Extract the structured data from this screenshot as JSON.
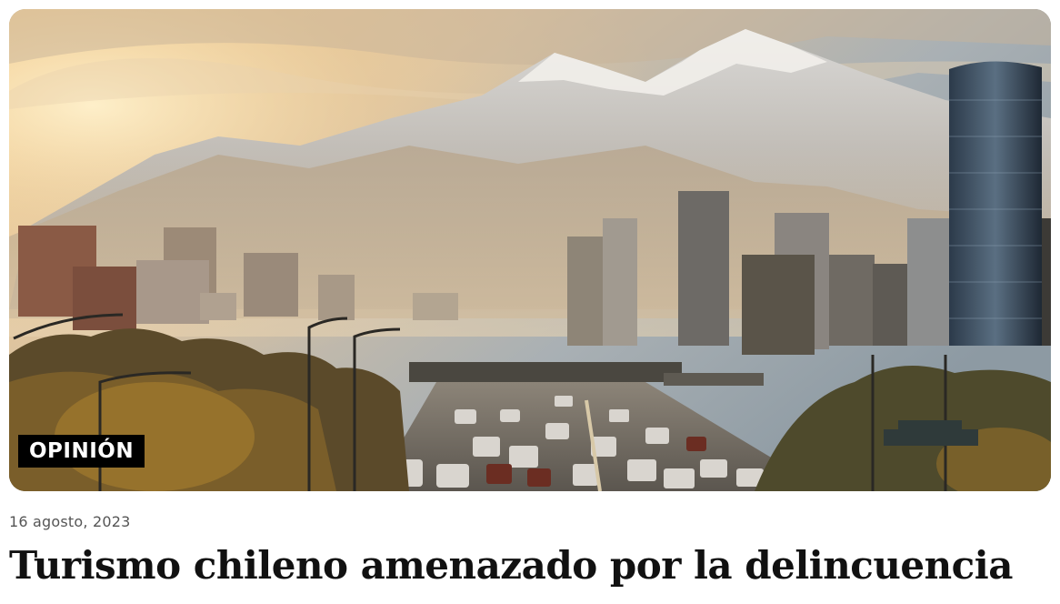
{
  "article": {
    "category_badge": "OPINIÓN",
    "date": "16 agosto, 2023",
    "title": "Turismo chileno amenazado por la delincuencia",
    "image_subject": "city-skyline-with-mountains-and-traffic"
  },
  "colors": {
    "badge_bg": "#000000",
    "badge_text": "#ffffff",
    "title": "#111111",
    "date": "#555555"
  }
}
